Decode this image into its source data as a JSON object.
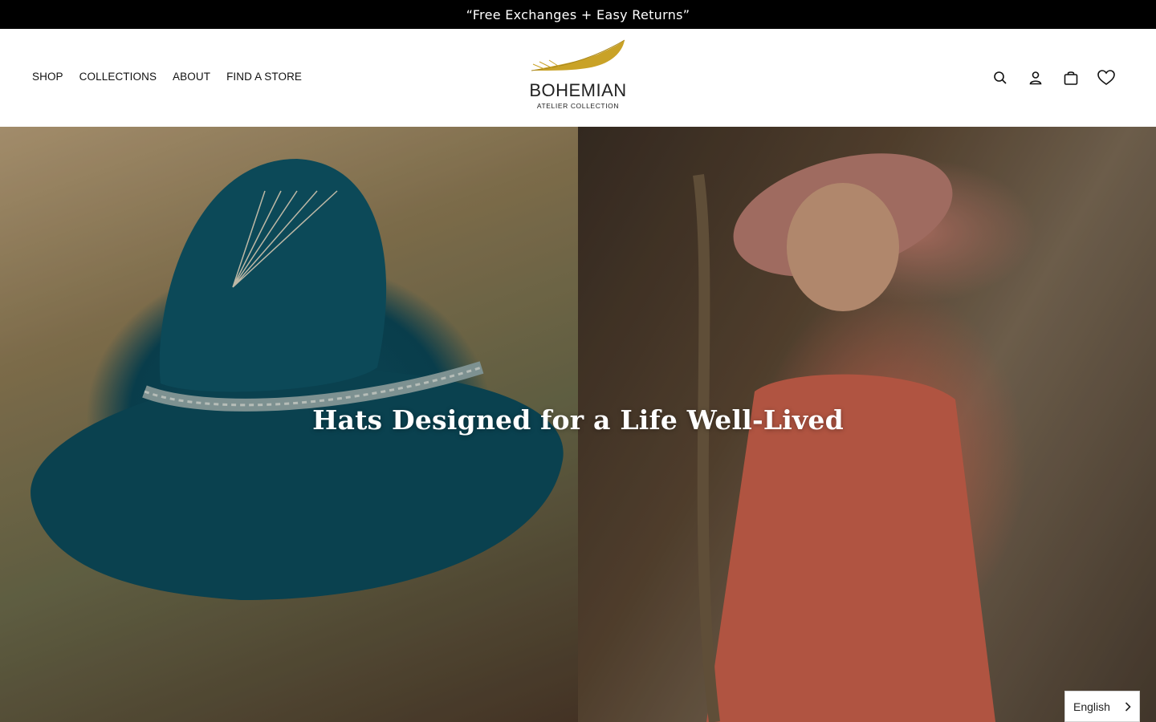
{
  "announcement": {
    "text": "“Free Exchanges + Easy Returns”"
  },
  "nav": {
    "items": [
      {
        "label": "SHOP"
      },
      {
        "label": "COLLECTIONS"
      },
      {
        "label": "ABOUT"
      },
      {
        "label": "FIND A STORE"
      }
    ]
  },
  "logo": {
    "brand": "BOHEMIAN",
    "sub": "ATELIER COLLECTION",
    "feather_color": "#c9a227"
  },
  "header_icons": [
    "search-icon",
    "account-icon",
    "cart-icon",
    "wishlist-icon"
  ],
  "hero": {
    "headline": "Hats Designed for a Life Well-Lived"
  },
  "language_selector": {
    "value": "English"
  },
  "colors": {
    "announcement_bg": "#000000",
    "text": "#111111",
    "accent": "#c9a227"
  }
}
